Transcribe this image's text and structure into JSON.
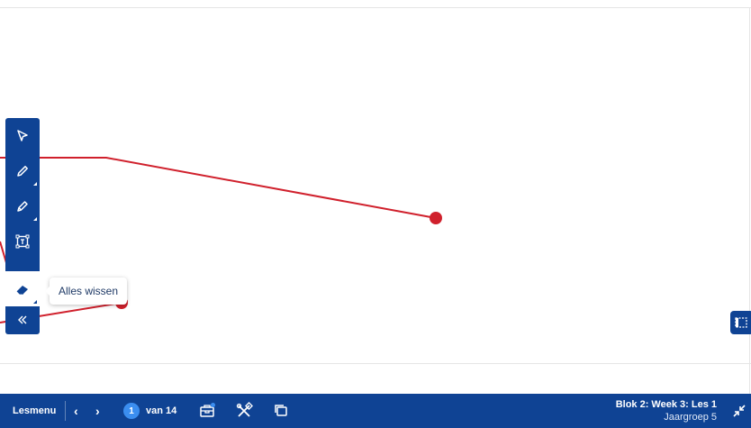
{
  "tooltip": {
    "text": "Alles wissen"
  },
  "toolbar": {
    "tools": [
      {
        "name": "select",
        "icon": "cursor-icon"
      },
      {
        "name": "pencil",
        "icon": "pencil-icon"
      },
      {
        "name": "marker",
        "icon": "marker-icon"
      },
      {
        "name": "textbox",
        "icon": "textbox-icon"
      },
      {
        "name": "eraser",
        "icon": "eraser-icon",
        "active": true
      },
      {
        "name": "collapse",
        "icon": "double-chevron-left-icon"
      }
    ]
  },
  "bottombar": {
    "lesmenu": "Lesmenu",
    "prev": "‹",
    "next": "›",
    "current_page": "1",
    "page_of": "van 14",
    "lesson_title": "Blok 2: Week 3: Les 1",
    "lesson_group": "Jaargroep 5"
  },
  "colors": {
    "primary": "#0f4394",
    "badge": "#3b8ef0",
    "annotation": "#d0202c"
  }
}
